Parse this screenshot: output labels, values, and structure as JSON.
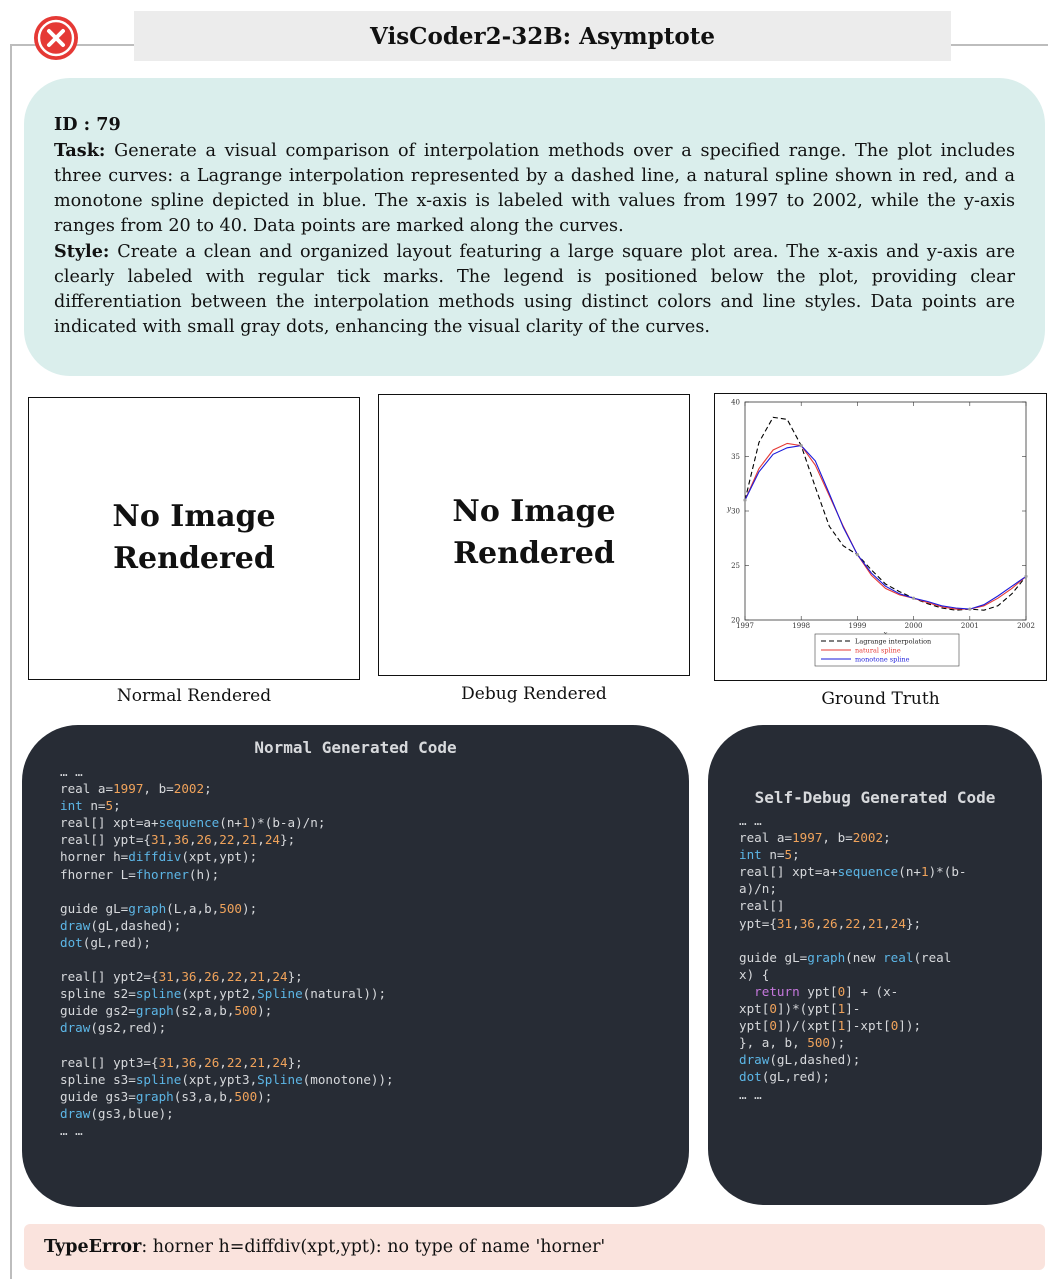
{
  "header": {
    "title": "VisCoder2-32B: Asymptote",
    "status_icon": "error-x-icon",
    "status_color": "#e53935"
  },
  "task": {
    "id_label": "ID : 79",
    "task_label": "Task:",
    "task_text": "Generate a visual comparison of interpolation methods over a specified range. The plot includes three curves: a Lagrange interpolation represented by a dashed line, a natural spline shown in red, and a monotone spline depicted in blue. The x-axis is labeled with values from 1997 to 2002, while the y-axis ranges from 20 to 40. Data points are marked along the curves.",
    "style_label": "Style:",
    "style_text": "Create a clean and organized layout featuring a large square plot area. The x-axis and y-axis are clearly labeled with regular tick marks. The legend is positioned below the plot, providing clear differentiation between the interpolation methods using distinct colors and line styles. Data points are indicated with small gray dots, enhancing the visual clarity of the curves."
  },
  "panels": {
    "normal": {
      "placeholder_line1": "No Image",
      "placeholder_line2": "Rendered",
      "caption": "Normal Rendered"
    },
    "debug": {
      "placeholder_line1": "No Image",
      "placeholder_line2": "Rendered",
      "caption": "Debug Rendered"
    },
    "truth": {
      "caption": "Ground Truth"
    }
  },
  "chart_data": {
    "type": "line",
    "xlabel": "x",
    "ylabel": "y",
    "xlim": [
      1997,
      2002
    ],
    "ylim": [
      20,
      40
    ],
    "xticks": [
      "1997",
      "1998",
      "1999",
      "2000",
      "2001",
      "2002"
    ],
    "yticks": [
      "20",
      "25",
      "30",
      "35",
      "40"
    ],
    "legend_position": "bottom",
    "series": [
      {
        "name": "Lagrange interpolation",
        "color": "#000000",
        "style": "dashed",
        "x": [
          1997,
          1997.25,
          1997.5,
          1997.75,
          1998,
          1998.25,
          1998.5,
          1998.75,
          1999,
          1999.25,
          1999.5,
          1999.75,
          2000,
          2000.25,
          2000.5,
          2000.75,
          2001,
          2001.25,
          2001.5,
          2001.75,
          2002
        ],
        "y": [
          31,
          36.3,
          38.6,
          38.4,
          36.0,
          32.2,
          28.6,
          26.8,
          26.0,
          24.6,
          23.3,
          22.6,
          22.0,
          21.5,
          21.1,
          20.9,
          21.0,
          20.9,
          21.3,
          22.4,
          24.0
        ]
      },
      {
        "name": "natural spline",
        "color": "#e53935",
        "style": "solid",
        "x": [
          1997,
          1997.25,
          1997.5,
          1997.75,
          1998,
          1998.25,
          1998.5,
          1998.75,
          1999,
          1999.25,
          1999.5,
          1999.75,
          2000,
          2000.25,
          2000.5,
          2000.75,
          2001,
          2001.25,
          2001.5,
          2001.75,
          2002
        ],
        "y": [
          31,
          33.9,
          35.6,
          36.2,
          36.0,
          34.2,
          31.4,
          28.6,
          26.0,
          24.1,
          22.9,
          22.3,
          22.0,
          21.6,
          21.2,
          21.0,
          21.0,
          21.3,
          22.0,
          22.9,
          24.0
        ]
      },
      {
        "name": "monotone spline",
        "color": "#1a1adb",
        "style": "solid",
        "x": [
          1997,
          1997.25,
          1997.5,
          1997.75,
          1998,
          1998.25,
          1998.5,
          1998.75,
          1999,
          1999.25,
          1999.5,
          1999.75,
          2000,
          2000.25,
          2000.5,
          2000.75,
          2001,
          2001.25,
          2001.5,
          2001.75,
          2002
        ],
        "y": [
          31,
          33.6,
          35.2,
          35.8,
          36.0,
          34.6,
          31.6,
          28.5,
          26.0,
          24.3,
          23.1,
          22.4,
          22.0,
          21.7,
          21.3,
          21.1,
          21.0,
          21.4,
          22.2,
          23.1,
          24.0
        ]
      }
    ],
    "points": {
      "x": [
        1997,
        1998,
        1999,
        2000,
        2001,
        2002
      ],
      "y": [
        31,
        36,
        26,
        22,
        21,
        24
      ],
      "color": "#9e9e9e"
    }
  },
  "code": {
    "normal_title": "Normal Generated Code",
    "debug_title": "Self-Debug Generated Code",
    "colors": {
      "background": "#272c35",
      "keyword": "#5cb6e6",
      "number": "#f0a35b",
      "control": "#c678dd"
    }
  },
  "error": {
    "label": "TypeError",
    "message": ": horner h=diffdiv(xpt,ypt): no type of name 'horner'"
  }
}
